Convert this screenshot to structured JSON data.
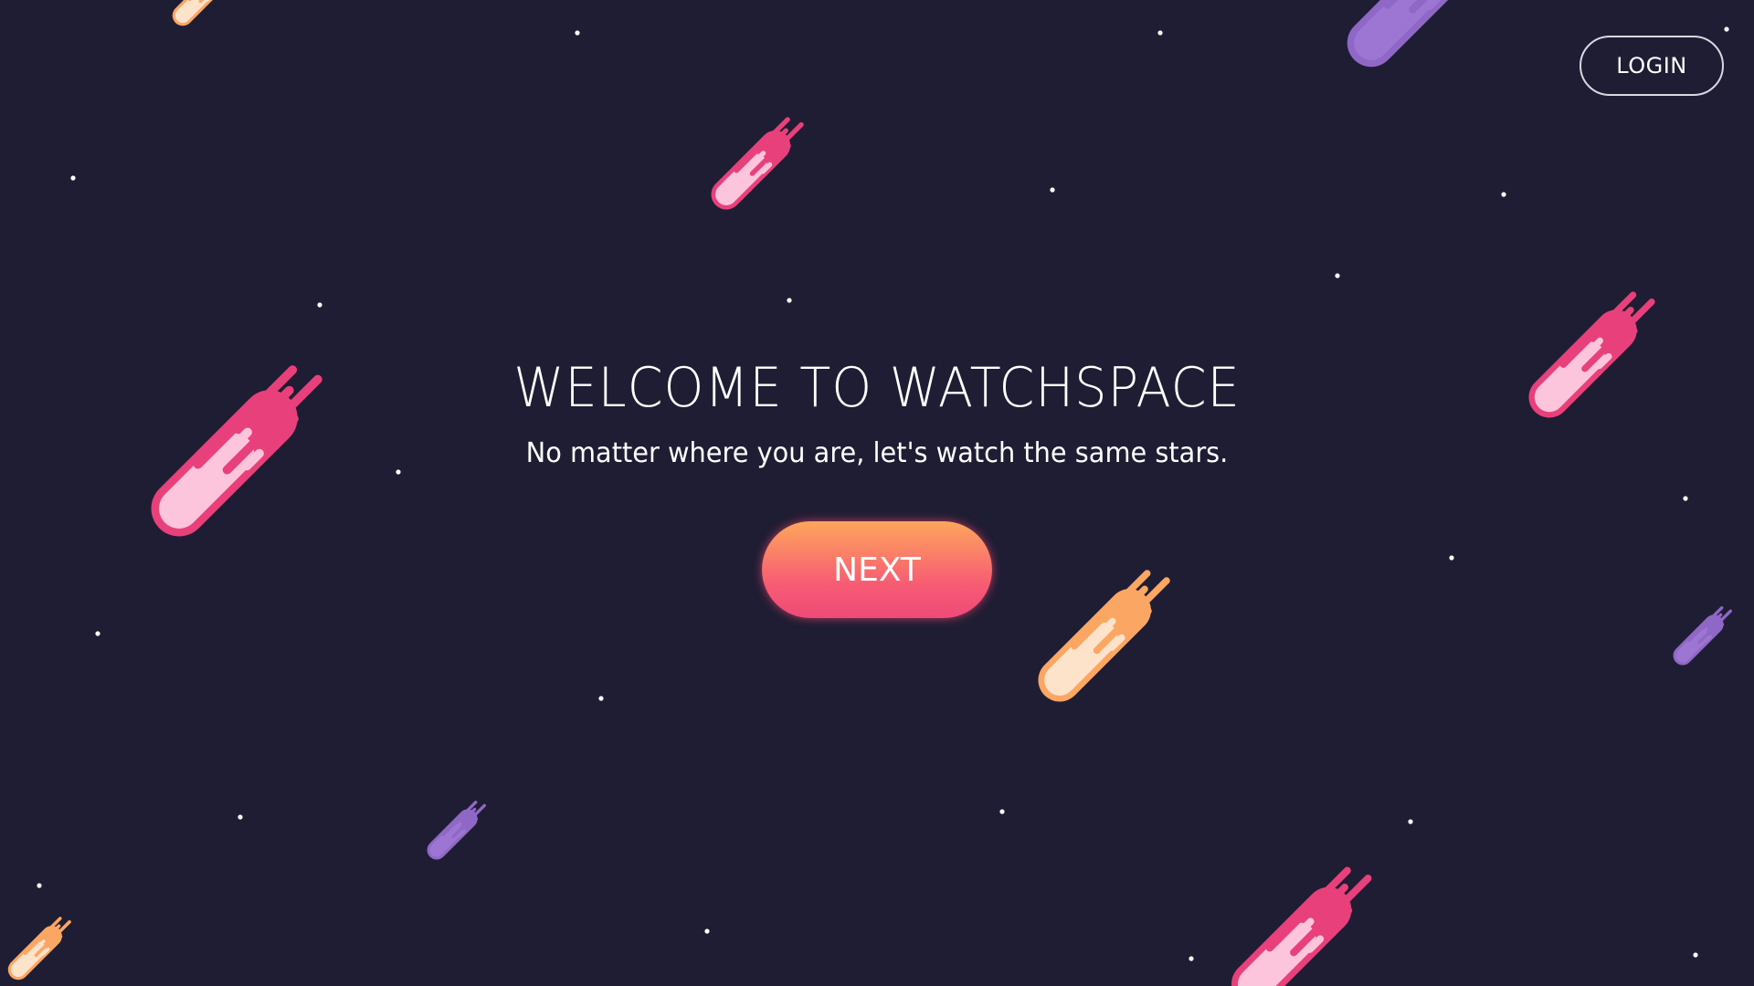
{
  "header": {
    "login_label": "LOGIN"
  },
  "hero": {
    "title": "WELCOME TO WATCHSPACE",
    "subtitle": "No matter where you are, let's watch the same stars.",
    "next_label": "NEXT"
  },
  "colors": {
    "background": "#1f1d33",
    "star": "#ffffff",
    "meteor_pink": {
      "outline": "#e8407a",
      "fill": "#fdc5db"
    },
    "meteor_orange": {
      "outline": "#fba663",
      "fill": "#fee3cb"
    },
    "meteor_purple": {
      "outline": "#8f68c7",
      "fill": "#9d76d4"
    },
    "button_gradient": [
      "#fda65c",
      "#f75c73",
      "#ee4a78"
    ],
    "login_border": "#d9d7e0"
  },
  "decorations": {
    "meteor_icons": [
      "pink-meteor-icon",
      "orange-meteor-icon",
      "purple-meteor-icon"
    ],
    "star_icon": "star-dot-icon"
  }
}
